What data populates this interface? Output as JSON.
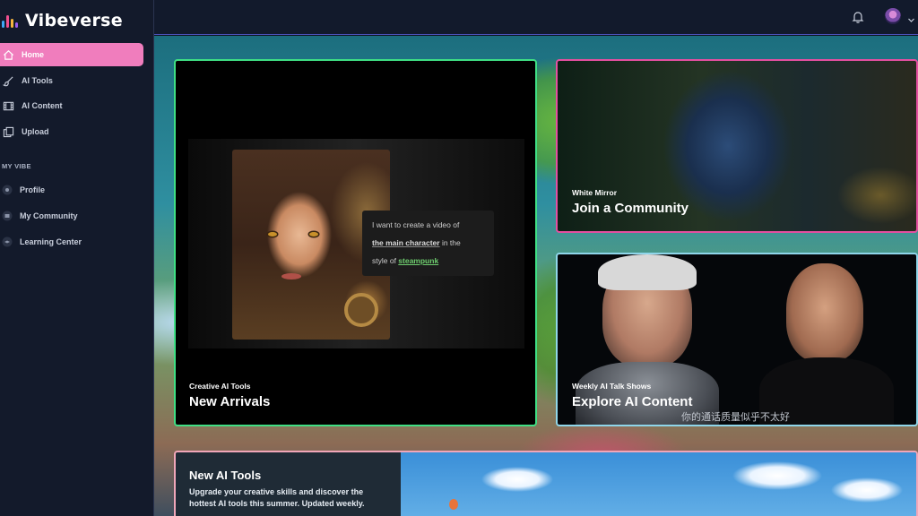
{
  "app": {
    "name": "Vibeverse"
  },
  "sidebar": {
    "items": [
      {
        "label": "Home",
        "icon": "home-icon",
        "active": true
      },
      {
        "label": "AI Tools",
        "icon": "brush-icon",
        "active": false
      },
      {
        "label": "AI Content",
        "icon": "film-icon",
        "active": false
      },
      {
        "label": "Upload",
        "icon": "copy-icon",
        "active": false
      }
    ],
    "section_label": "MY VIBE",
    "vibe_items": [
      {
        "label": "Profile",
        "icon": "profile-icon"
      },
      {
        "label": "My Community",
        "icon": "community-icon"
      },
      {
        "label": "Learning Center",
        "icon": "learning-icon"
      }
    ]
  },
  "topbar": {
    "bell_icon": "bell-icon",
    "avatar_icon": "avatar",
    "menu_icon": "chevron-down-icon"
  },
  "cards": {
    "arrivals": {
      "eyebrow": "Creative AI Tools",
      "title": "New Arrivals",
      "prompt": {
        "line1": "I want to create a video of",
        "highlight1": "the main character",
        "after1": " in the",
        "before2": "style of ",
        "highlight2": "steampunk"
      }
    },
    "community": {
      "eyebrow": "White Mirror",
      "title": "Join a Community"
    },
    "talk": {
      "eyebrow": "Weekly AI Talk Shows",
      "title": "Explore AI Content",
      "subtitle": "你的通话质量似乎不太好"
    },
    "tools": {
      "title": "New AI Tools",
      "description": "Upgrade your creative skills and discover the hottest AI tools this summer. Updated weekly."
    }
  },
  "colors": {
    "accent_pink": "#f07dbd",
    "arrivals_border": "#3fdf84",
    "community_border": "#e44fa0",
    "talk_border": "#8fd6ea",
    "steampunk_green": "#6fcf6f"
  }
}
